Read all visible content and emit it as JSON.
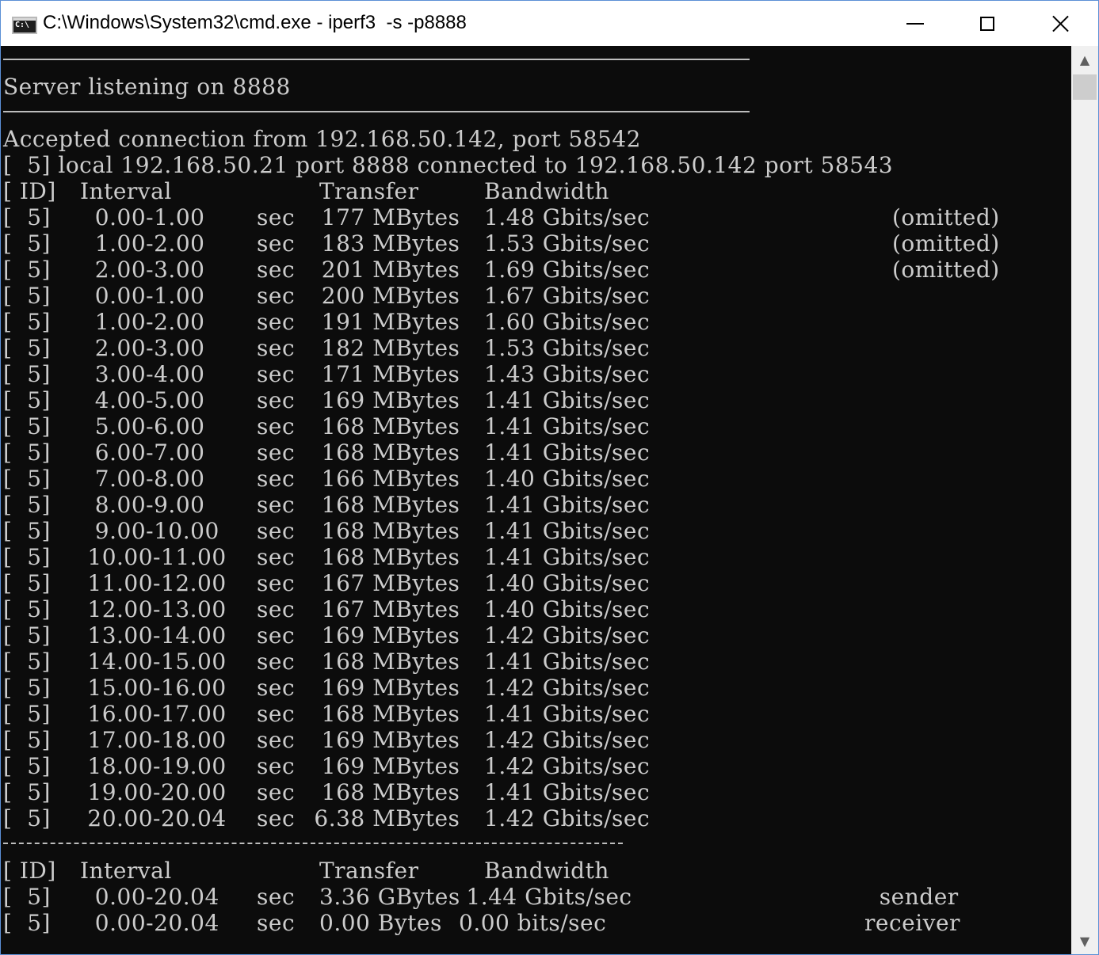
{
  "window": {
    "title": "C:\\Windows\\System32\\cmd.exe - iperf3  -s -p8888",
    "icon_text": "C:\\",
    "icon": "cmd-icon",
    "controls": {
      "minimize_icon": "minimize-icon",
      "maximize_icon": "maximize-icon",
      "close_icon": "close-icon"
    }
  },
  "console": {
    "text_color": "#cccccc",
    "background": "#0c0c0c",
    "listening": "Server listening on 8888",
    "accepted": "Accepted connection from 192.168.50.142, port 58542",
    "local": "[  5] local 192.168.50.21 port 8888 connected to 192.168.50.142 port 58543",
    "header": {
      "id": "[ ID]",
      "interval": "Interval",
      "transfer": "Transfer",
      "bandwidth": "Bandwidth"
    },
    "rows": [
      {
        "id": "[  5]",
        "interval": "  0.00-1.00",
        "unit": "sec",
        "transfer": "  177 MBytes",
        "bandwidth": "1.48 Gbits/sec",
        "note": "(omitted)"
      },
      {
        "id": "[  5]",
        "interval": "  1.00-2.00",
        "unit": "sec",
        "transfer": "  183 MBytes",
        "bandwidth": "1.53 Gbits/sec",
        "note": "(omitted)"
      },
      {
        "id": "[  5]",
        "interval": "  2.00-3.00",
        "unit": "sec",
        "transfer": "  201 MBytes",
        "bandwidth": "1.69 Gbits/sec",
        "note": "(omitted)"
      },
      {
        "id": "[  5]",
        "interval": "  0.00-1.00",
        "unit": "sec",
        "transfer": "  200 MBytes",
        "bandwidth": "1.67 Gbits/sec",
        "note": ""
      },
      {
        "id": "[  5]",
        "interval": "  1.00-2.00",
        "unit": "sec",
        "transfer": "  191 MBytes",
        "bandwidth": "1.60 Gbits/sec",
        "note": ""
      },
      {
        "id": "[  5]",
        "interval": "  2.00-3.00",
        "unit": "sec",
        "transfer": "  182 MBytes",
        "bandwidth": "1.53 Gbits/sec",
        "note": ""
      },
      {
        "id": "[  5]",
        "interval": "  3.00-4.00",
        "unit": "sec",
        "transfer": "  171 MBytes",
        "bandwidth": "1.43 Gbits/sec",
        "note": ""
      },
      {
        "id": "[  5]",
        "interval": "  4.00-5.00",
        "unit": "sec",
        "transfer": "  169 MBytes",
        "bandwidth": "1.41 Gbits/sec",
        "note": ""
      },
      {
        "id": "[  5]",
        "interval": "  5.00-6.00",
        "unit": "sec",
        "transfer": "  168 MBytes",
        "bandwidth": "1.41 Gbits/sec",
        "note": ""
      },
      {
        "id": "[  5]",
        "interval": "  6.00-7.00",
        "unit": "sec",
        "transfer": "  168 MBytes",
        "bandwidth": "1.41 Gbits/sec",
        "note": ""
      },
      {
        "id": "[  5]",
        "interval": "  7.00-8.00",
        "unit": "sec",
        "transfer": "  166 MBytes",
        "bandwidth": "1.40 Gbits/sec",
        "note": ""
      },
      {
        "id": "[  5]",
        "interval": "  8.00-9.00",
        "unit": "sec",
        "transfer": "  168 MBytes",
        "bandwidth": "1.41 Gbits/sec",
        "note": ""
      },
      {
        "id": "[  5]",
        "interval": "  9.00-10.00",
        "unit": "sec",
        "transfer": "  168 MBytes",
        "bandwidth": "1.41 Gbits/sec",
        "note": ""
      },
      {
        "id": "[  5]",
        "interval": " 10.00-11.00",
        "unit": "sec",
        "transfer": "  168 MBytes",
        "bandwidth": "1.41 Gbits/sec",
        "note": ""
      },
      {
        "id": "[  5]",
        "interval": " 11.00-12.00",
        "unit": "sec",
        "transfer": "  167 MBytes",
        "bandwidth": "1.40 Gbits/sec",
        "note": ""
      },
      {
        "id": "[  5]",
        "interval": " 12.00-13.00",
        "unit": "sec",
        "transfer": "  167 MBytes",
        "bandwidth": "1.40 Gbits/sec",
        "note": ""
      },
      {
        "id": "[  5]",
        "interval": " 13.00-14.00",
        "unit": "sec",
        "transfer": "  169 MBytes",
        "bandwidth": "1.42 Gbits/sec",
        "note": ""
      },
      {
        "id": "[  5]",
        "interval": " 14.00-15.00",
        "unit": "sec",
        "transfer": "  168 MBytes",
        "bandwidth": "1.41 Gbits/sec",
        "note": ""
      },
      {
        "id": "[  5]",
        "interval": " 15.00-16.00",
        "unit": "sec",
        "transfer": "  169 MBytes",
        "bandwidth": "1.42 Gbits/sec",
        "note": ""
      },
      {
        "id": "[  5]",
        "interval": " 16.00-17.00",
        "unit": "sec",
        "transfer": "  168 MBytes",
        "bandwidth": "1.41 Gbits/sec",
        "note": ""
      },
      {
        "id": "[  5]",
        "interval": " 17.00-18.00",
        "unit": "sec",
        "transfer": "  169 MBytes",
        "bandwidth": "1.42 Gbits/sec",
        "note": ""
      },
      {
        "id": "[  5]",
        "interval": " 18.00-19.00",
        "unit": "sec",
        "transfer": "  169 MBytes",
        "bandwidth": "1.42 Gbits/sec",
        "note": ""
      },
      {
        "id": "[  5]",
        "interval": " 19.00-20.00",
        "unit": "sec",
        "transfer": "  168 MBytes",
        "bandwidth": "1.41 Gbits/sec",
        "note": ""
      },
      {
        "id": "[  5]",
        "interval": " 20.00-20.04",
        "unit": "sec",
        "transfer": " 6.38 MBytes",
        "bandwidth": "1.42 Gbits/sec",
        "note": ""
      }
    ],
    "summary_header": {
      "id": "[ ID]",
      "interval": "Interval",
      "transfer": "Transfer",
      "bandwidth": "Bandwidth"
    },
    "summary_rows": [
      {
        "id": "[  5]",
        "interval": "  0.00-20.04",
        "unit": "sec",
        "transfer": "3.36 GBytes",
        "bandwidth": " 1.44 Gbits/sec",
        "note": "  sender"
      },
      {
        "id": "[  5]",
        "interval": "  0.00-20.04",
        "unit": "sec",
        "transfer": "0.00 Bytes",
        "bandwidth": "0.00 bits/sec",
        "note": "receiver"
      }
    ]
  },
  "scrollbar": {
    "up_icon": "scroll-up-icon",
    "up_glyph": "▲",
    "down_icon": "scroll-down-icon",
    "down_glyph": "▼"
  }
}
